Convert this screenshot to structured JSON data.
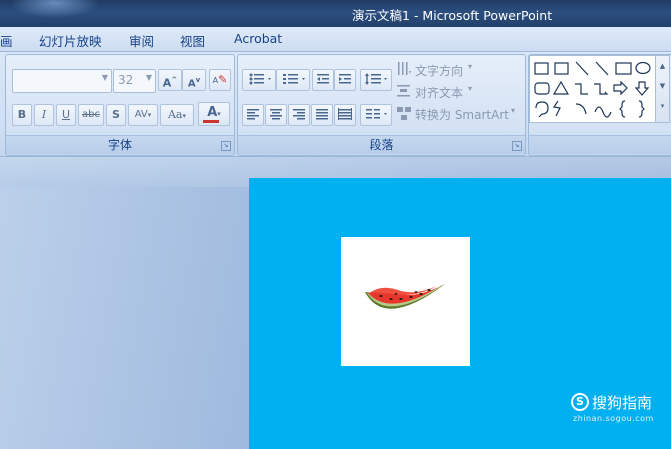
{
  "window": {
    "title": "演示文稿1 - Microsoft PowerPoint"
  },
  "menu": {
    "items": [
      "画",
      "幻灯片放映",
      "审阅",
      "视图",
      "Acrobat"
    ]
  },
  "ribbon": {
    "font_group": {
      "label": "字体",
      "font_name": "",
      "font_size": "32",
      "grow": "A",
      "shrink": "A",
      "clear_format": "A",
      "bold": "B",
      "italic": "I",
      "underline": "U",
      "strikethrough": "abc",
      "shadow": "S",
      "char_spacing": "AV",
      "change_case": "Aa",
      "font_color": "A"
    },
    "paragraph_group": {
      "label": "段落",
      "text_direction": "文字方向",
      "align_text": "对齐文本",
      "convert_smartart": "转换为 SmartArt"
    }
  },
  "watermark": {
    "brand": "搜狗指南",
    "url": "zhinan.sogou.com",
    "logo": "S"
  },
  "colors": {
    "slide_bg": "#00b0f0",
    "title_bar": "#2c4f80",
    "ribbon": "#dbe7f6"
  },
  "slide": {
    "image": "watermelon-slice"
  }
}
